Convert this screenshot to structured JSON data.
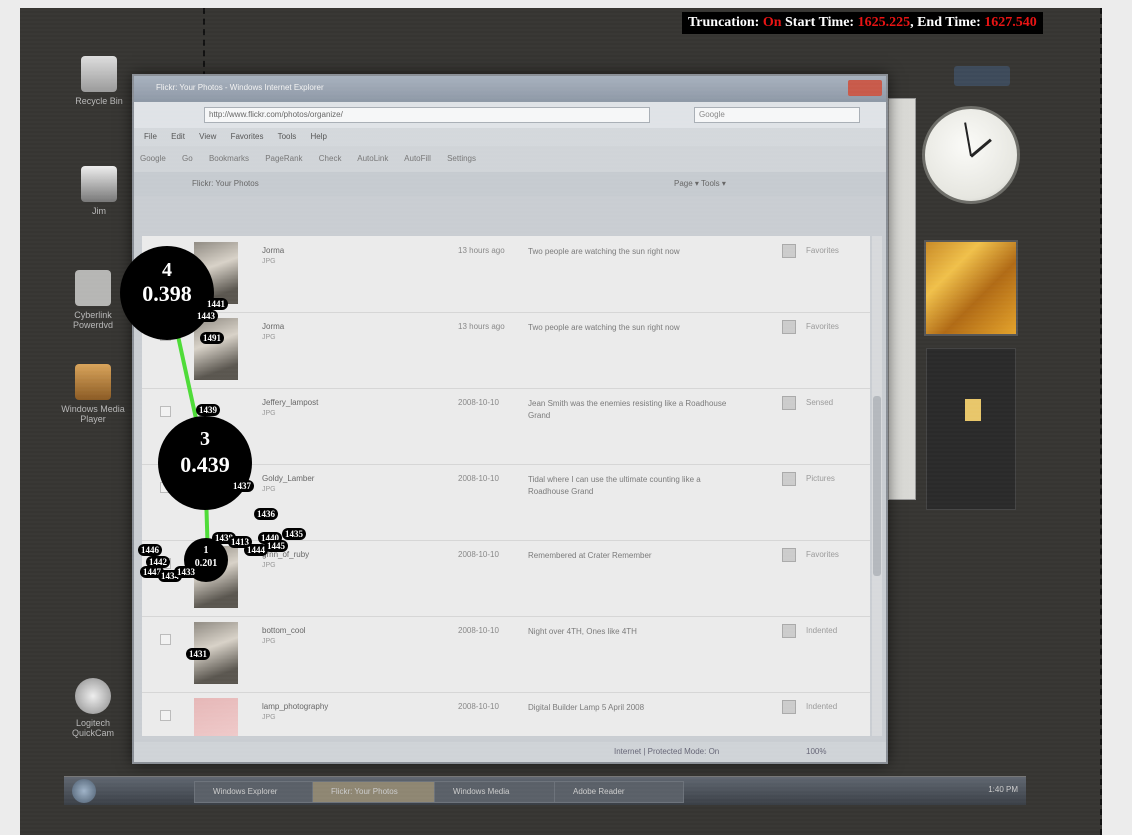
{
  "overlay": {
    "truncation_label": "Truncation:",
    "truncation_value": "On",
    "start_label": "Start Time:",
    "start_value": "1625.225",
    "end_label": "End Time:",
    "end_value": "1627.540"
  },
  "desktop": {
    "icons": [
      {
        "label": "Recycle Bin",
        "icon": "recycle-bin-icon"
      },
      {
        "label": "Jim",
        "icon": "user-folder-icon"
      },
      {
        "label": "Cyberlink Powerdvd",
        "icon": "dvd-player-icon"
      },
      {
        "label": "Windows Media Player",
        "icon": "media-player-icon"
      },
      {
        "label": "Logitech QuickCam",
        "icon": "webcam-icon"
      }
    ]
  },
  "browser": {
    "title": "Flickr: Your Photos - Windows Internet Explorer",
    "url": "http://www.flickr.com/photos/organize/",
    "search_placeholder": "Google",
    "menu": [
      "File",
      "Edit",
      "View",
      "Favorites",
      "Tools",
      "Help"
    ],
    "toolbar": [
      "Google",
      "Go",
      "Bookmarks",
      "PageRank",
      "Check",
      "AutoLink",
      "AutoFill",
      "Settings"
    ],
    "tab_label": "Flickr: Your Photos",
    "tab_tools": "Page ▾  Tools ▾",
    "rows": [
      {
        "name": "Jorma",
        "sub": "JPG",
        "date": "13 hours ago",
        "desc": "Two people are watching the sun right now",
        "tag": "Favorites"
      },
      {
        "name": "Jorma",
        "sub": "JPG",
        "date": "13 hours ago",
        "desc": "Two people are watching the sun right now",
        "tag": "Favorites"
      },
      {
        "name": "Jeffery_lampost",
        "sub": "JPG",
        "date": "2008-10-10",
        "desc": "Jean Smith was the enemies resisting like a Roadhouse Grand",
        "tag": "Sensed"
      },
      {
        "name": "Goldy_Lamber",
        "sub": "JPG",
        "date": "2008-10-10",
        "desc": "Tidal where I can use the ultimate counting like a Roadhouse Grand",
        "tag": "Pictures"
      },
      {
        "name": "grnn_of_ruby",
        "sub": "JPG",
        "date": "2008-10-10",
        "desc": "Remembered at Crater Remember",
        "tag": "Favorites"
      },
      {
        "name": "bottom_cool",
        "sub": "JPG",
        "date": "2008-10-10",
        "desc": "Night over 4TH, Ones like 4TH",
        "tag": "Indented"
      },
      {
        "name": "lamp_photography",
        "sub": "JPG",
        "date": "2008-10-10",
        "desc": "Digital Builder Lamp 5 April 2008",
        "tag": "Indented"
      }
    ],
    "status_zone": "Internet | Protected Mode: On",
    "status_zoom": "100%"
  },
  "taskbar": {
    "buttons": [
      "Windows Explorer",
      "Flickr: Your Photos",
      "Windows Media",
      "Adobe Reader"
    ],
    "tray_time": "1:40 PM"
  },
  "fixations": [
    {
      "id": "4",
      "value": "0.398"
    },
    {
      "id": "3",
      "value": "0.439"
    },
    {
      "id": "1",
      "value": "0.201"
    }
  ],
  "mini_labels": [
    "1441",
    "1443",
    "1491",
    "1439",
    "1436",
    "1437",
    "1438",
    "1413",
    "1440",
    "1435",
    "1446",
    "1442",
    "1447",
    "1434",
    "1433",
    "1445",
    "1444",
    "1431"
  ],
  "colors": {
    "fixation_path": "#4fdc39",
    "overlay_highlight": "#e81414",
    "desktop_background": "#363532"
  }
}
